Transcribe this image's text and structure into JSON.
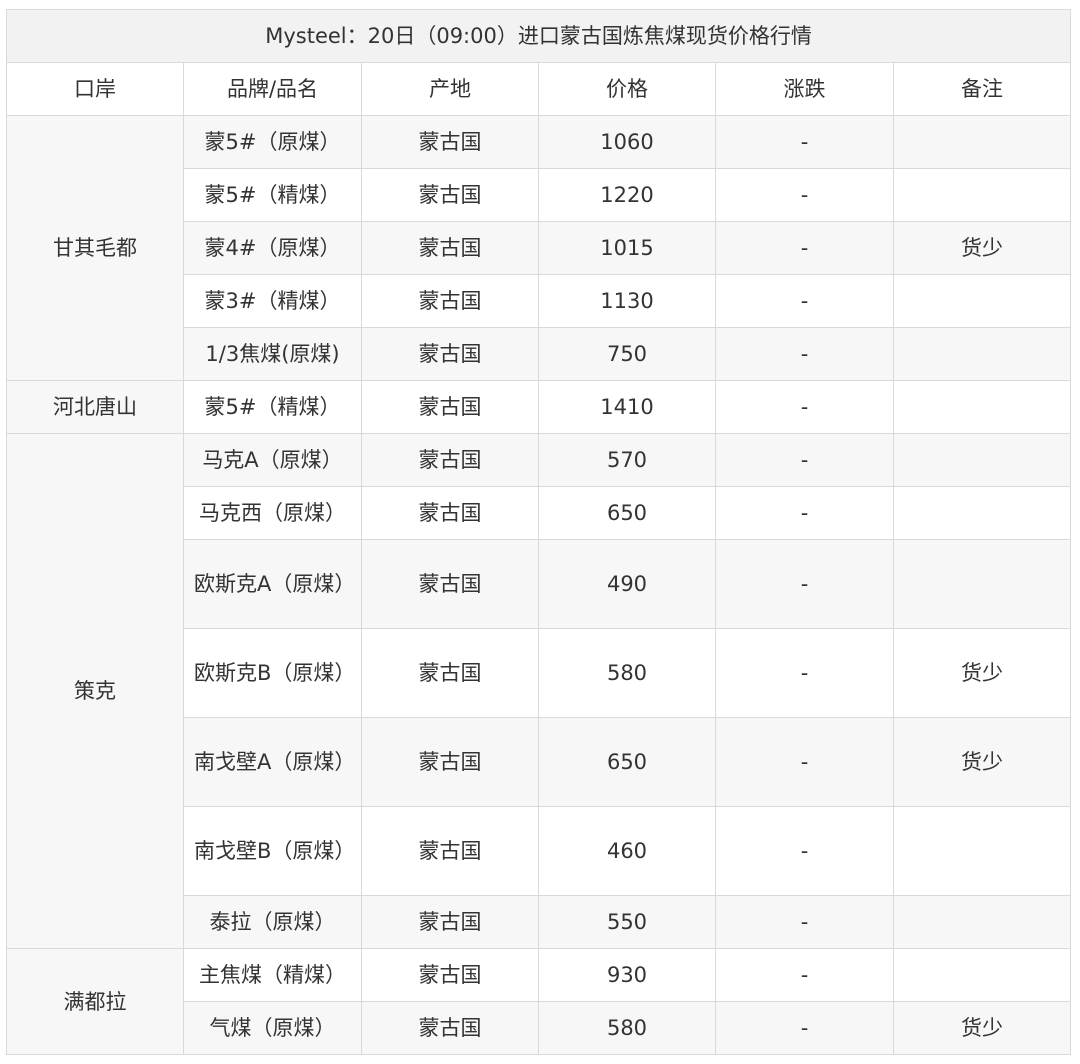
{
  "table": {
    "title": "Mysteel：20日（09:00）进口蒙古国炼焦煤现货价格行情",
    "headers": [
      "口岸",
      "品牌/品名",
      "产地",
      "价格",
      "涨跌",
      "备注"
    ],
    "groups": [
      {
        "port": "甘其毛都",
        "rows": [
          {
            "brand": "蒙5#（原煤）",
            "origin": "蒙古国",
            "price": "1060",
            "change": "-",
            "note": ""
          },
          {
            "brand": "蒙5#（精煤）",
            "origin": "蒙古国",
            "price": "1220",
            "change": "-",
            "note": ""
          },
          {
            "brand": "蒙4#（原煤）",
            "origin": "蒙古国",
            "price": "1015",
            "change": "-",
            "note": "货少"
          },
          {
            "brand": "蒙3#（精煤）",
            "origin": "蒙古国",
            "price": "1130",
            "change": "-",
            "note": ""
          },
          {
            "brand": "1/3焦煤(原煤)",
            "origin": "蒙古国",
            "price": "750",
            "change": "-",
            "note": ""
          }
        ]
      },
      {
        "port": "河北唐山",
        "rows": [
          {
            "brand": "蒙5#（精煤）",
            "origin": "蒙古国",
            "price": "1410",
            "change": "-",
            "note": ""
          }
        ]
      },
      {
        "port": "策克",
        "rows": [
          {
            "brand": "马克A（原煤）",
            "origin": "蒙古国",
            "price": "570",
            "change": "-",
            "note": ""
          },
          {
            "brand": "马克西（原煤）",
            "origin": "蒙古国",
            "price": "650",
            "change": "-",
            "note": ""
          },
          {
            "brand": "欧斯克A（原煤）",
            "origin": "蒙古国",
            "price": "490",
            "change": "-",
            "note": ""
          },
          {
            "brand": "欧斯克B（原煤）",
            "origin": "蒙古国",
            "price": "580",
            "change": "-",
            "note": "货少"
          },
          {
            "brand": "南戈壁A（原煤）",
            "origin": "蒙古国",
            "price": "650",
            "change": "-",
            "note": "货少"
          },
          {
            "brand": "南戈壁B（原煤）",
            "origin": "蒙古国",
            "price": "460",
            "change": "-",
            "note": ""
          },
          {
            "brand": "泰拉（原煤）",
            "origin": "蒙古国",
            "price": "550",
            "change": "-",
            "note": ""
          }
        ]
      },
      {
        "port": "满都拉",
        "rows": [
          {
            "brand": "主焦煤（精煤）",
            "origin": "蒙古国",
            "price": "930",
            "change": "-",
            "note": ""
          },
          {
            "brand": "气煤（原煤）",
            "origin": "蒙古国",
            "price": "580",
            "change": "-",
            "note": "货少"
          }
        ]
      }
    ]
  }
}
